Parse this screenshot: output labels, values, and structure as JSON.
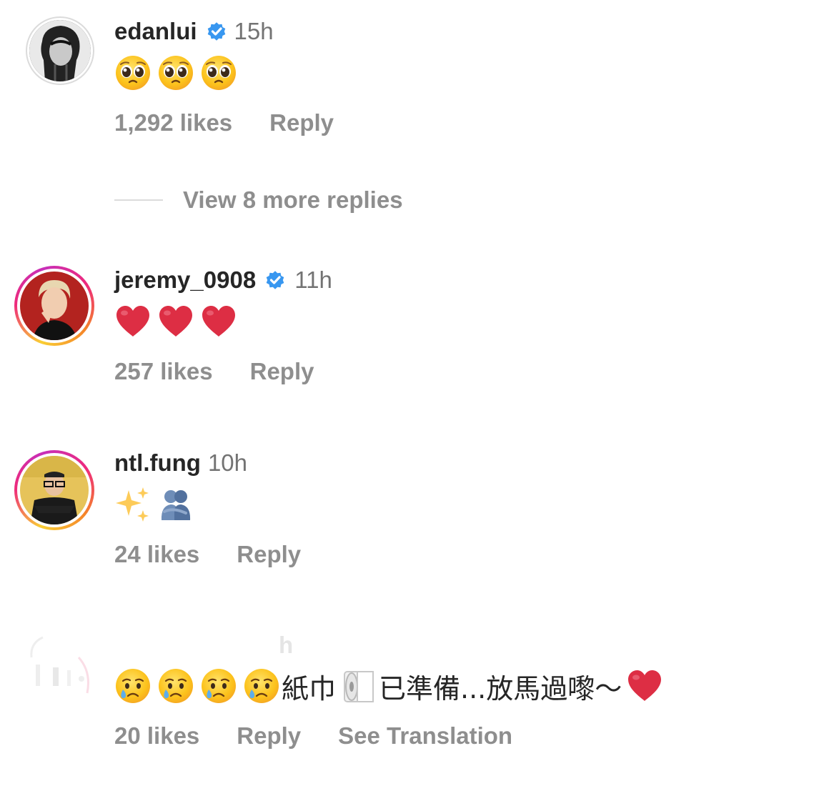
{
  "comments": [
    {
      "username": "edanlui",
      "verified": true,
      "time": "15h",
      "likes": "1,292 likes",
      "reply": "Reply"
    },
    {
      "username": "jeremy_0908",
      "verified": true,
      "time": "11h",
      "likes": "257 likes",
      "reply": "Reply"
    },
    {
      "username": "ntl.fung",
      "verified": false,
      "time": "10h",
      "likes": "24 likes",
      "reply": "Reply"
    },
    {
      "username_faded": "h",
      "text_a": "紙巾",
      "text_b": "已準備...放馬過嚟～",
      "likes": "20 likes",
      "reply": "Reply",
      "see_translation": "See Translation"
    }
  ],
  "view_more": "View 8 more replies",
  "icons": {
    "verified": "verified-badge-icon",
    "emoji_pleading": "pleading-face-emoji",
    "emoji_heart": "red-heart-emoji",
    "emoji_sparkles": "sparkles-emoji",
    "emoji_hug": "people-hugging-emoji",
    "emoji_crying": "crying-face-emoji",
    "emoji_tissue": "roll-of-paper-emoji"
  },
  "colors": {
    "text": "#262626",
    "muted": "#8e8e8e",
    "verified": "#3897f0",
    "heart": "#dd2e44"
  }
}
